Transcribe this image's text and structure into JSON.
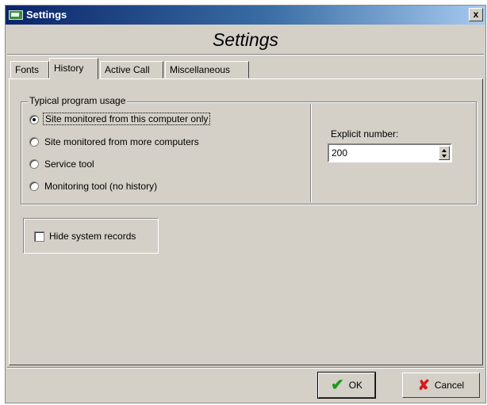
{
  "window": {
    "title": "Settings",
    "close_glyph": "x"
  },
  "header": {
    "title": "Settings"
  },
  "tabs": [
    {
      "label": "Fonts",
      "active": false
    },
    {
      "label": "History",
      "active": true
    },
    {
      "label": "Active Call",
      "active": false
    },
    {
      "label": "Miscellaneous",
      "active": false
    }
  ],
  "history": {
    "group_label": "Typical program usage",
    "options": [
      {
        "label": "Site monitored from this computer only",
        "selected": true
      },
      {
        "label": "Site monitored from more computers",
        "selected": false
      },
      {
        "label": "Service tool",
        "selected": false
      },
      {
        "label": "Monitoring tool (no history)",
        "selected": false
      }
    ],
    "explicit_label": "Explicit number:",
    "explicit_value": "200",
    "hide_system_records_label": "Hide system records",
    "hide_system_records_checked": false
  },
  "buttons": {
    "ok_label": "OK",
    "cancel_label": "Cancel"
  },
  "icons": {
    "ok": "checkmark-icon",
    "cancel": "x-mark-icon"
  },
  "colors": {
    "titlebar_start": "#0a246a",
    "ok_icon": "#1f9a1f",
    "cancel_icon": "#d21c1c"
  }
}
